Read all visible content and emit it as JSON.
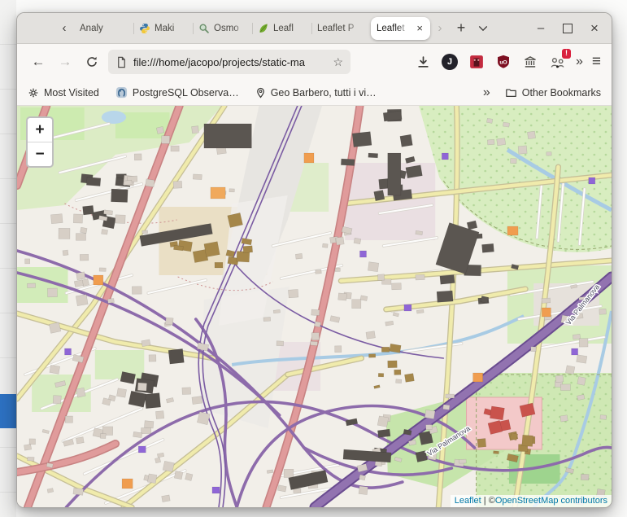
{
  "glyphs": {
    "chevron_left": "‹",
    "chevron_right": "›",
    "new_tab": "+",
    "minimize": "–",
    "close_window": "×",
    "back": "←",
    "forward": "→",
    "overflow": "»",
    "menu": "≡",
    "star": "☆",
    "close_tab": "×"
  },
  "tabbar": {
    "tabs": [
      {
        "label": "Analy"
      },
      {
        "label": "Maki",
        "icon": "python-icon"
      },
      {
        "label": "Osmo",
        "icon": "magnifier-icon"
      },
      {
        "label": "Leafl",
        "icon": "leaflet-leaf-icon"
      },
      {
        "label": "Leaflet P"
      },
      {
        "label": "Leaflet",
        "active": true
      }
    ]
  },
  "toolbar": {
    "url": "file:///home/jacopo/projects/static-ma",
    "avatar": "J",
    "ublock": "uO",
    "badge": "!"
  },
  "bookmarks": {
    "most_visited": "Most Visited",
    "postgres": "PostgreSQL Observa…",
    "geo": "Geo Barbero, tutti i vi…",
    "other": "Other Bookmarks"
  },
  "map": {
    "zoom_in": "+",
    "zoom_out": "−",
    "road_label": "Via Palmanova",
    "attribution_leaflet": "Leaflet",
    "attribution_sep": " | ©",
    "attribution_osm": "OpenStreetMap contributors"
  },
  "colors": {
    "accent_blue_panel": "#2e73c5",
    "link_blue": "#0078A8",
    "map_background": "#f2efe9",
    "park_green": "#cdebb0",
    "primary_road_pink": "#e09b9b",
    "secondary_road_yellow": "#f0ebac",
    "trunk_purple": "#9273b0",
    "water_blue": "#a8cbe4",
    "building_gray": "#d7cfc6",
    "building_dark": "#5b5651",
    "ublock_red": "#7e1022",
    "badge_red": "#d91f3d"
  }
}
